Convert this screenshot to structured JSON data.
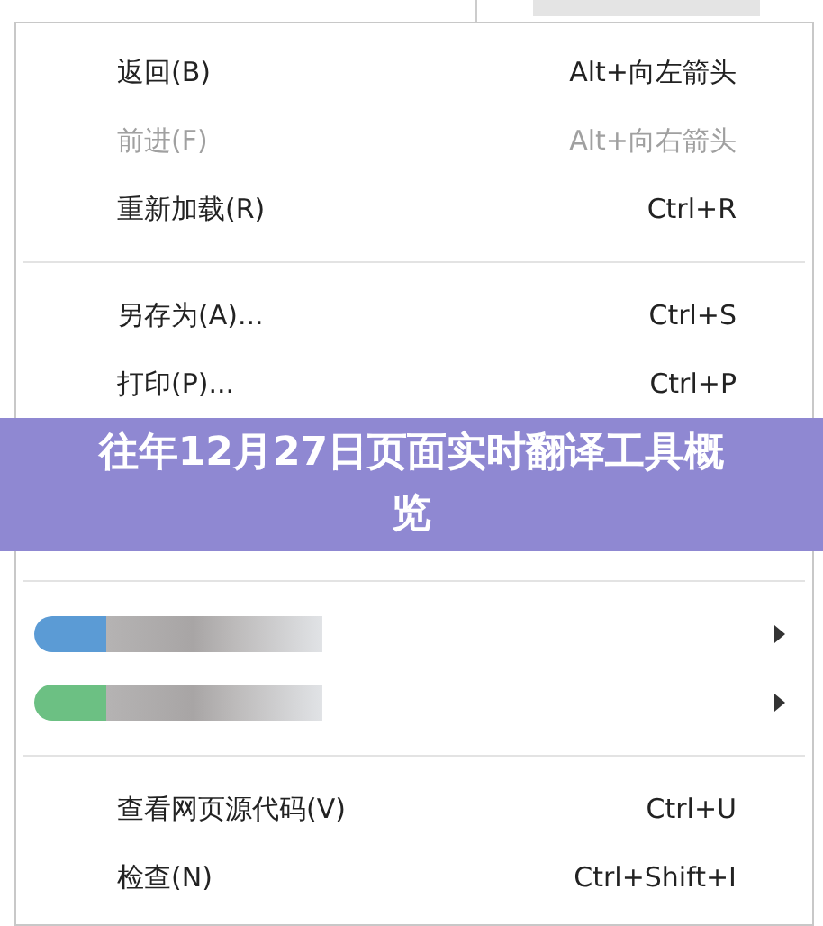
{
  "menu": {
    "groups": [
      [
        {
          "label": "返回(B)",
          "shortcut": "Alt+向左箭头",
          "disabled": false
        },
        {
          "label": "前进(F)",
          "shortcut": "Alt+向右箭头",
          "disabled": true
        },
        {
          "label": "重新加载(R)",
          "shortcut": "Ctrl+R",
          "disabled": false
        }
      ],
      [
        {
          "label": "另存为(A)...",
          "shortcut": "Ctrl+S",
          "disabled": false
        },
        {
          "label": "打印(P)...",
          "shortcut": "Ctrl+P",
          "disabled": false
        }
      ],
      [
        {
          "kind": "blurred",
          "color": "#5b9bd5",
          "submenu": true
        },
        {
          "kind": "blurred",
          "color": "#6cc083",
          "submenu": true
        }
      ],
      [
        {
          "label": "查看网页源代码(V)",
          "shortcut": "Ctrl+U",
          "disabled": false
        },
        {
          "label": "检查(N)",
          "shortcut": "Ctrl+Shift+I",
          "disabled": false
        }
      ]
    ]
  },
  "banner": {
    "title": "往年12月27日页面实时翻译工具概览"
  }
}
